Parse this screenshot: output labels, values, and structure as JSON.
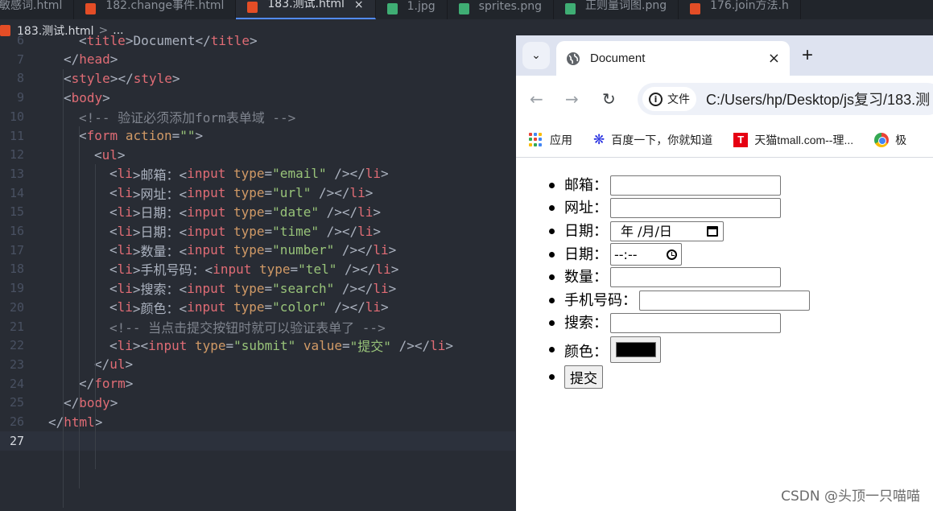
{
  "editor": {
    "tabs": [
      {
        "label": "敏感词.html",
        "icon": "html-file-icon",
        "active": false
      },
      {
        "label": "182.change事件.html",
        "icon": "html-file-icon",
        "active": false
      },
      {
        "label": "183.测试.html",
        "icon": "html-file-icon",
        "active": true
      },
      {
        "label": "1.jpg",
        "icon": "image-file-icon",
        "active": false
      },
      {
        "label": "sprites.png",
        "icon": "image-file-icon",
        "active": false
      },
      {
        "label": "正则量词图.png",
        "icon": "image-file-icon",
        "active": false
      },
      {
        "label": "176.join方法.h",
        "icon": "html-file-icon",
        "active": false
      }
    ],
    "close_glyph": "×",
    "breadcrumb": {
      "file": "183.测试.html",
      "separator": ">",
      "trail": "..."
    },
    "lines": [
      {
        "n": "6",
        "indent": 2,
        "tokens": [
          [
            "p",
            "<"
          ],
          [
            "tag",
            "title"
          ],
          [
            "p",
            ">"
          ],
          [
            "p",
            "Document"
          ],
          [
            "p",
            "</"
          ],
          [
            "tag",
            "title"
          ],
          [
            "p",
            ">"
          ]
        ]
      },
      {
        "n": "7",
        "indent": 1,
        "tokens": [
          [
            "p",
            "</"
          ],
          [
            "tag",
            "head"
          ],
          [
            "p",
            ">"
          ]
        ]
      },
      {
        "n": "8",
        "indent": 1,
        "tokens": [
          [
            "p",
            "<"
          ],
          [
            "tag",
            "style"
          ],
          [
            "p",
            "></"
          ],
          [
            "tag",
            "style"
          ],
          [
            "p",
            ">"
          ]
        ]
      },
      {
        "n": "9",
        "indent": 1,
        "tokens": [
          [
            "p",
            "<"
          ],
          [
            "tag",
            "body"
          ],
          [
            "p",
            ">"
          ]
        ]
      },
      {
        "n": "10",
        "indent": 2,
        "tokens": [
          [
            "cmt",
            "<!-- 验证必须添加form表单域 -->"
          ]
        ]
      },
      {
        "n": "11",
        "indent": 2,
        "tokens": [
          [
            "p",
            "<"
          ],
          [
            "tag",
            "form"
          ],
          [
            "p",
            " "
          ],
          [
            "attr",
            "action"
          ],
          [
            "p",
            "="
          ],
          [
            "str",
            "\"\""
          ],
          [
            "p",
            ">"
          ]
        ]
      },
      {
        "n": "12",
        "indent": 3,
        "tokens": [
          [
            "p",
            "<"
          ],
          [
            "tag",
            "ul"
          ],
          [
            "p",
            ">"
          ]
        ]
      },
      {
        "n": "13",
        "indent": 4,
        "tokens": [
          [
            "p",
            "<"
          ],
          [
            "tag",
            "li"
          ],
          [
            "p",
            ">邮箱：<"
          ],
          [
            "tag",
            "input"
          ],
          [
            "p",
            " "
          ],
          [
            "attr",
            "type"
          ],
          [
            "p",
            "="
          ],
          [
            "str",
            "\"email\""
          ],
          [
            "p",
            " /></"
          ],
          [
            "tag",
            "li"
          ],
          [
            "p",
            ">"
          ]
        ]
      },
      {
        "n": "14",
        "indent": 4,
        "tokens": [
          [
            "p",
            "<"
          ],
          [
            "tag",
            "li"
          ],
          [
            "p",
            ">网址：<"
          ],
          [
            "tag",
            "input"
          ],
          [
            "p",
            " "
          ],
          [
            "attr",
            "type"
          ],
          [
            "p",
            "="
          ],
          [
            "str",
            "\"url\""
          ],
          [
            "p",
            " /></"
          ],
          [
            "tag",
            "li"
          ],
          [
            "p",
            ">"
          ]
        ]
      },
      {
        "n": "15",
        "indent": 4,
        "tokens": [
          [
            "p",
            "<"
          ],
          [
            "tag",
            "li"
          ],
          [
            "p",
            ">日期：<"
          ],
          [
            "tag",
            "input"
          ],
          [
            "p",
            " "
          ],
          [
            "attr",
            "type"
          ],
          [
            "p",
            "="
          ],
          [
            "str",
            "\"date\""
          ],
          [
            "p",
            " /></"
          ],
          [
            "tag",
            "li"
          ],
          [
            "p",
            ">"
          ]
        ]
      },
      {
        "n": "16",
        "indent": 4,
        "tokens": [
          [
            "p",
            "<"
          ],
          [
            "tag",
            "li"
          ],
          [
            "p",
            ">日期：<"
          ],
          [
            "tag",
            "input"
          ],
          [
            "p",
            " "
          ],
          [
            "attr",
            "type"
          ],
          [
            "p",
            "="
          ],
          [
            "str",
            "\"time\""
          ],
          [
            "p",
            " /></"
          ],
          [
            "tag",
            "li"
          ],
          [
            "p",
            ">"
          ]
        ]
      },
      {
        "n": "17",
        "indent": 4,
        "tokens": [
          [
            "p",
            "<"
          ],
          [
            "tag",
            "li"
          ],
          [
            "p",
            ">数量：<"
          ],
          [
            "tag",
            "input"
          ],
          [
            "p",
            " "
          ],
          [
            "attr",
            "type"
          ],
          [
            "p",
            "="
          ],
          [
            "str",
            "\"number\""
          ],
          [
            "p",
            " /></"
          ],
          [
            "tag",
            "li"
          ],
          [
            "p",
            ">"
          ]
        ]
      },
      {
        "n": "18",
        "indent": 4,
        "tokens": [
          [
            "p",
            "<"
          ],
          [
            "tag",
            "li"
          ],
          [
            "p",
            ">手机号码：<"
          ],
          [
            "tag",
            "input"
          ],
          [
            "p",
            " "
          ],
          [
            "attr",
            "type"
          ],
          [
            "p",
            "="
          ],
          [
            "str",
            "\"tel\""
          ],
          [
            "p",
            " /></"
          ],
          [
            "tag",
            "li"
          ],
          [
            "p",
            ">"
          ]
        ]
      },
      {
        "n": "19",
        "indent": 4,
        "tokens": [
          [
            "p",
            "<"
          ],
          [
            "tag",
            "li"
          ],
          [
            "p",
            ">搜索：<"
          ],
          [
            "tag",
            "input"
          ],
          [
            "p",
            " "
          ],
          [
            "attr",
            "type"
          ],
          [
            "p",
            "="
          ],
          [
            "str",
            "\"search\""
          ],
          [
            "p",
            " /></"
          ],
          [
            "tag",
            "li"
          ],
          [
            "p",
            ">"
          ]
        ]
      },
      {
        "n": "20",
        "indent": 4,
        "tokens": [
          [
            "p",
            "<"
          ],
          [
            "tag",
            "li"
          ],
          [
            "p",
            ">颜色：<"
          ],
          [
            "tag",
            "input"
          ],
          [
            "p",
            " "
          ],
          [
            "attr",
            "type"
          ],
          [
            "p",
            "="
          ],
          [
            "str",
            "\"color\""
          ],
          [
            "p",
            " /></"
          ],
          [
            "tag",
            "li"
          ],
          [
            "p",
            ">"
          ]
        ]
      },
      {
        "n": "21",
        "indent": 4,
        "tokens": [
          [
            "cmt",
            "<!-- 当点击提交按钮时就可以验证表单了 -->"
          ]
        ]
      },
      {
        "n": "22",
        "indent": 4,
        "tokens": [
          [
            "p",
            "<"
          ],
          [
            "tag",
            "li"
          ],
          [
            "p",
            "><"
          ],
          [
            "tag",
            "input"
          ],
          [
            "p",
            " "
          ],
          [
            "attr",
            "type"
          ],
          [
            "p",
            "="
          ],
          [
            "str",
            "\"submit\""
          ],
          [
            "p",
            " "
          ],
          [
            "attr",
            "value"
          ],
          [
            "p",
            "="
          ],
          [
            "str",
            "\"提交\""
          ],
          [
            "p",
            " /></"
          ],
          [
            "tag",
            "li"
          ],
          [
            "p",
            ">"
          ]
        ]
      },
      {
        "n": "23",
        "indent": 3,
        "tokens": [
          [
            "p",
            "</"
          ],
          [
            "tag",
            "ul"
          ],
          [
            "p",
            ">"
          ]
        ]
      },
      {
        "n": "24",
        "indent": 2,
        "tokens": [
          [
            "p",
            "</"
          ],
          [
            "tag",
            "form"
          ],
          [
            "p",
            ">"
          ]
        ]
      },
      {
        "n": "25",
        "indent": 1,
        "tokens": [
          [
            "p",
            "</"
          ],
          [
            "tag",
            "body"
          ],
          [
            "p",
            ">"
          ]
        ]
      },
      {
        "n": "26",
        "indent": 0,
        "tokens": [
          [
            "p",
            "</"
          ],
          [
            "tag",
            "html"
          ],
          [
            "p",
            ">"
          ]
        ]
      },
      {
        "n": "27",
        "indent": 0,
        "tokens": [],
        "current": true
      }
    ]
  },
  "browser": {
    "tab_title": "Document",
    "tab_close": "×",
    "new_tab": "+",
    "chip_label": "文件",
    "url": "C:/Users/hp/Desktop/js复习/183.测",
    "bookmarks": [
      {
        "label": "应用",
        "icon": "apps-grid-icon"
      },
      {
        "label": "百度一下，你就知道",
        "icon": "baidu-paw-icon"
      },
      {
        "label": "天猫tmall.com--理...",
        "icon": "tmall-icon"
      },
      {
        "label": "极",
        "icon": "chrome-icon"
      }
    ],
    "form": {
      "email_label": "邮箱：",
      "url_label": "网址：",
      "date_label": "日期：",
      "date_value": "年 /月/日",
      "time_label": "日期：",
      "time_value": "--:--",
      "number_label": "数量：",
      "tel_label": "手机号码：",
      "search_label": "搜索：",
      "color_label": "颜色：",
      "color_value": "#000000",
      "submit_label": "提交"
    }
  },
  "watermark": "CSDN @头顶一只喵喵",
  "colors": {
    "tag": "#e06c75",
    "attr": "#d19a66",
    "string": "#98c379",
    "comment": "#7f848e",
    "editor_bg": "#282c34"
  }
}
